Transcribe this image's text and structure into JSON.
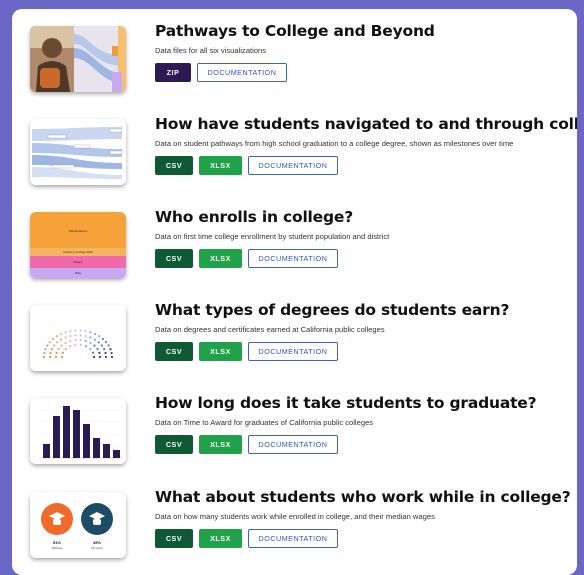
{
  "items": [
    {
      "title": "Pathways to College and Beyond",
      "description": "Data files for all six visualizations",
      "buttons": [
        "ZIP",
        "DOCUMENTATION"
      ]
    },
    {
      "title": "How have students navigated to and through college?",
      "description": "Data on student pathways from high school graduation to a college degree, shown as milestones over time",
      "buttons": [
        "CSV",
        "XLSX",
        "DOCUMENTATION"
      ]
    },
    {
      "title": "Who enrolls in college?",
      "description": "Data on first time college enrollment by student population and district",
      "buttons": [
        "CSV",
        "XLSX",
        "DOCUMENTATION"
      ]
    },
    {
      "title": "What types of degrees do students earn?",
      "description": "Data on degrees and certificates earned at California public colleges",
      "buttons": [
        "CSV",
        "XLSX",
        "DOCUMENTATION"
      ]
    },
    {
      "title": "How long does it take students to graduate?",
      "description": "Data on Time to Award for graduates of California public colleges",
      "buttons": [
        "CSV",
        "XLSX",
        "DOCUMENTATION"
      ]
    },
    {
      "title": "What about students who work while in college?",
      "description": "Data on how many students work while enrolled in college, and their median wages",
      "buttons": [
        "CSV",
        "XLSX",
        "DOCUMENTATION"
      ]
    }
  ],
  "thumbnails": {
    "enroll_labels": [
      "Total Enrollment",
      "Students in a college district",
      "Hispanic",
      "White"
    ],
    "work_labels": {
      "left_value": "51%",
      "left_caption": "Worked",
      "right_value": "49%",
      "right_caption": "No work"
    }
  },
  "colors": {
    "background": "#6a68c4",
    "zip": "#2b1b55",
    "csv": "#0e5a34",
    "xlsx": "#1fa24a",
    "doc_text": "#2f57b8",
    "accent_orange": "#f7a13a",
    "accent_pink": "#f06aaa",
    "accent_lavender": "#c9a8f3",
    "bars": "#2b1b55"
  }
}
